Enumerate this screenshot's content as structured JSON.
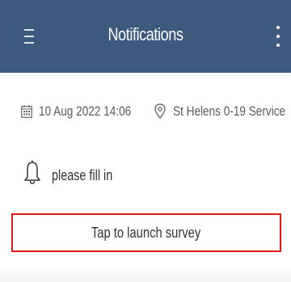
{
  "header": {
    "title": "Notifications",
    "background": "#3d5a7e",
    "menu_icon": "hamburger-menu-icon",
    "overflow_icon": "more-vertical-icon"
  },
  "notification": {
    "date": "10 Aug 2022 14:06",
    "date_icon": "calendar-icon",
    "location": "St Helens 0-19 Service",
    "location_icon": "location-pin-icon",
    "message_icon": "bell-icon",
    "message": "please fill in",
    "action_label": "Tap to launch survey",
    "action_border": "#e01818"
  }
}
